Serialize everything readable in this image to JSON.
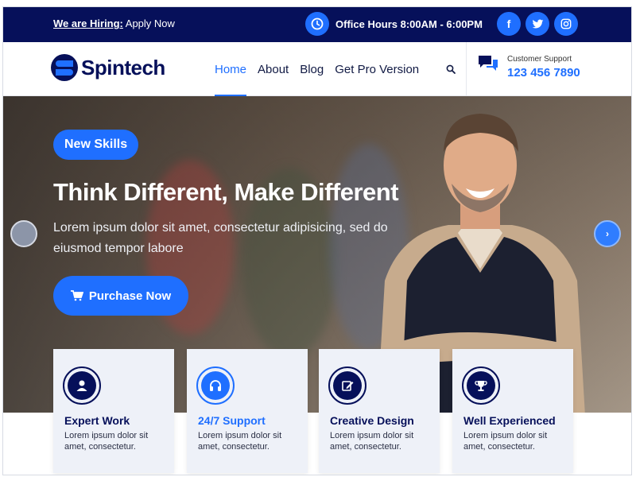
{
  "topbar": {
    "hiring_bold": "We are Hiring:",
    "hiring_rest": " Apply Now",
    "hours": "Office Hours 8:00AM - 6:00PM",
    "socials": [
      {
        "icon": "facebook-icon",
        "glyph": "f"
      },
      {
        "icon": "twitter-icon",
        "glyph": "t"
      },
      {
        "icon": "instagram-icon",
        "glyph": "◎"
      }
    ]
  },
  "header": {
    "logo_text": "Spintech",
    "nav": [
      {
        "label": "Home",
        "active": true
      },
      {
        "label": "About",
        "active": false
      },
      {
        "label": "Blog",
        "active": false
      },
      {
        "label": "Get Pro Version",
        "active": false
      }
    ],
    "support_label": "Customer Support",
    "support_phone": "123 456 7890"
  },
  "hero": {
    "badge": "New Skills",
    "title": "Think Different, Make Different",
    "subtitle": "Lorem ipsum dolor sit amet, consectetur adipisicing, sed do eiusmod tempor labore",
    "cta": "Purchase Now"
  },
  "features": [
    {
      "title": "Expert Work",
      "desc": "Lorem ipsum dolor sit amet, consectetur.",
      "icon": "user-icon",
      "highlight": false
    },
    {
      "title": "24/7 Support",
      "desc": "Lorem ipsum dolor sit amet, consectetur.",
      "icon": "headphones-icon",
      "highlight": true
    },
    {
      "title": "Creative Design",
      "desc": "Lorem ipsum dolor sit amet, consectetur.",
      "icon": "edit-icon",
      "highlight": false
    },
    {
      "title": "Well Experienced",
      "desc": "Lorem ipsum dolor sit amet, consectetur.",
      "icon": "trophy-icon",
      "highlight": false
    }
  ],
  "colors": {
    "navy": "#06105a",
    "accent": "#1f6fff"
  }
}
